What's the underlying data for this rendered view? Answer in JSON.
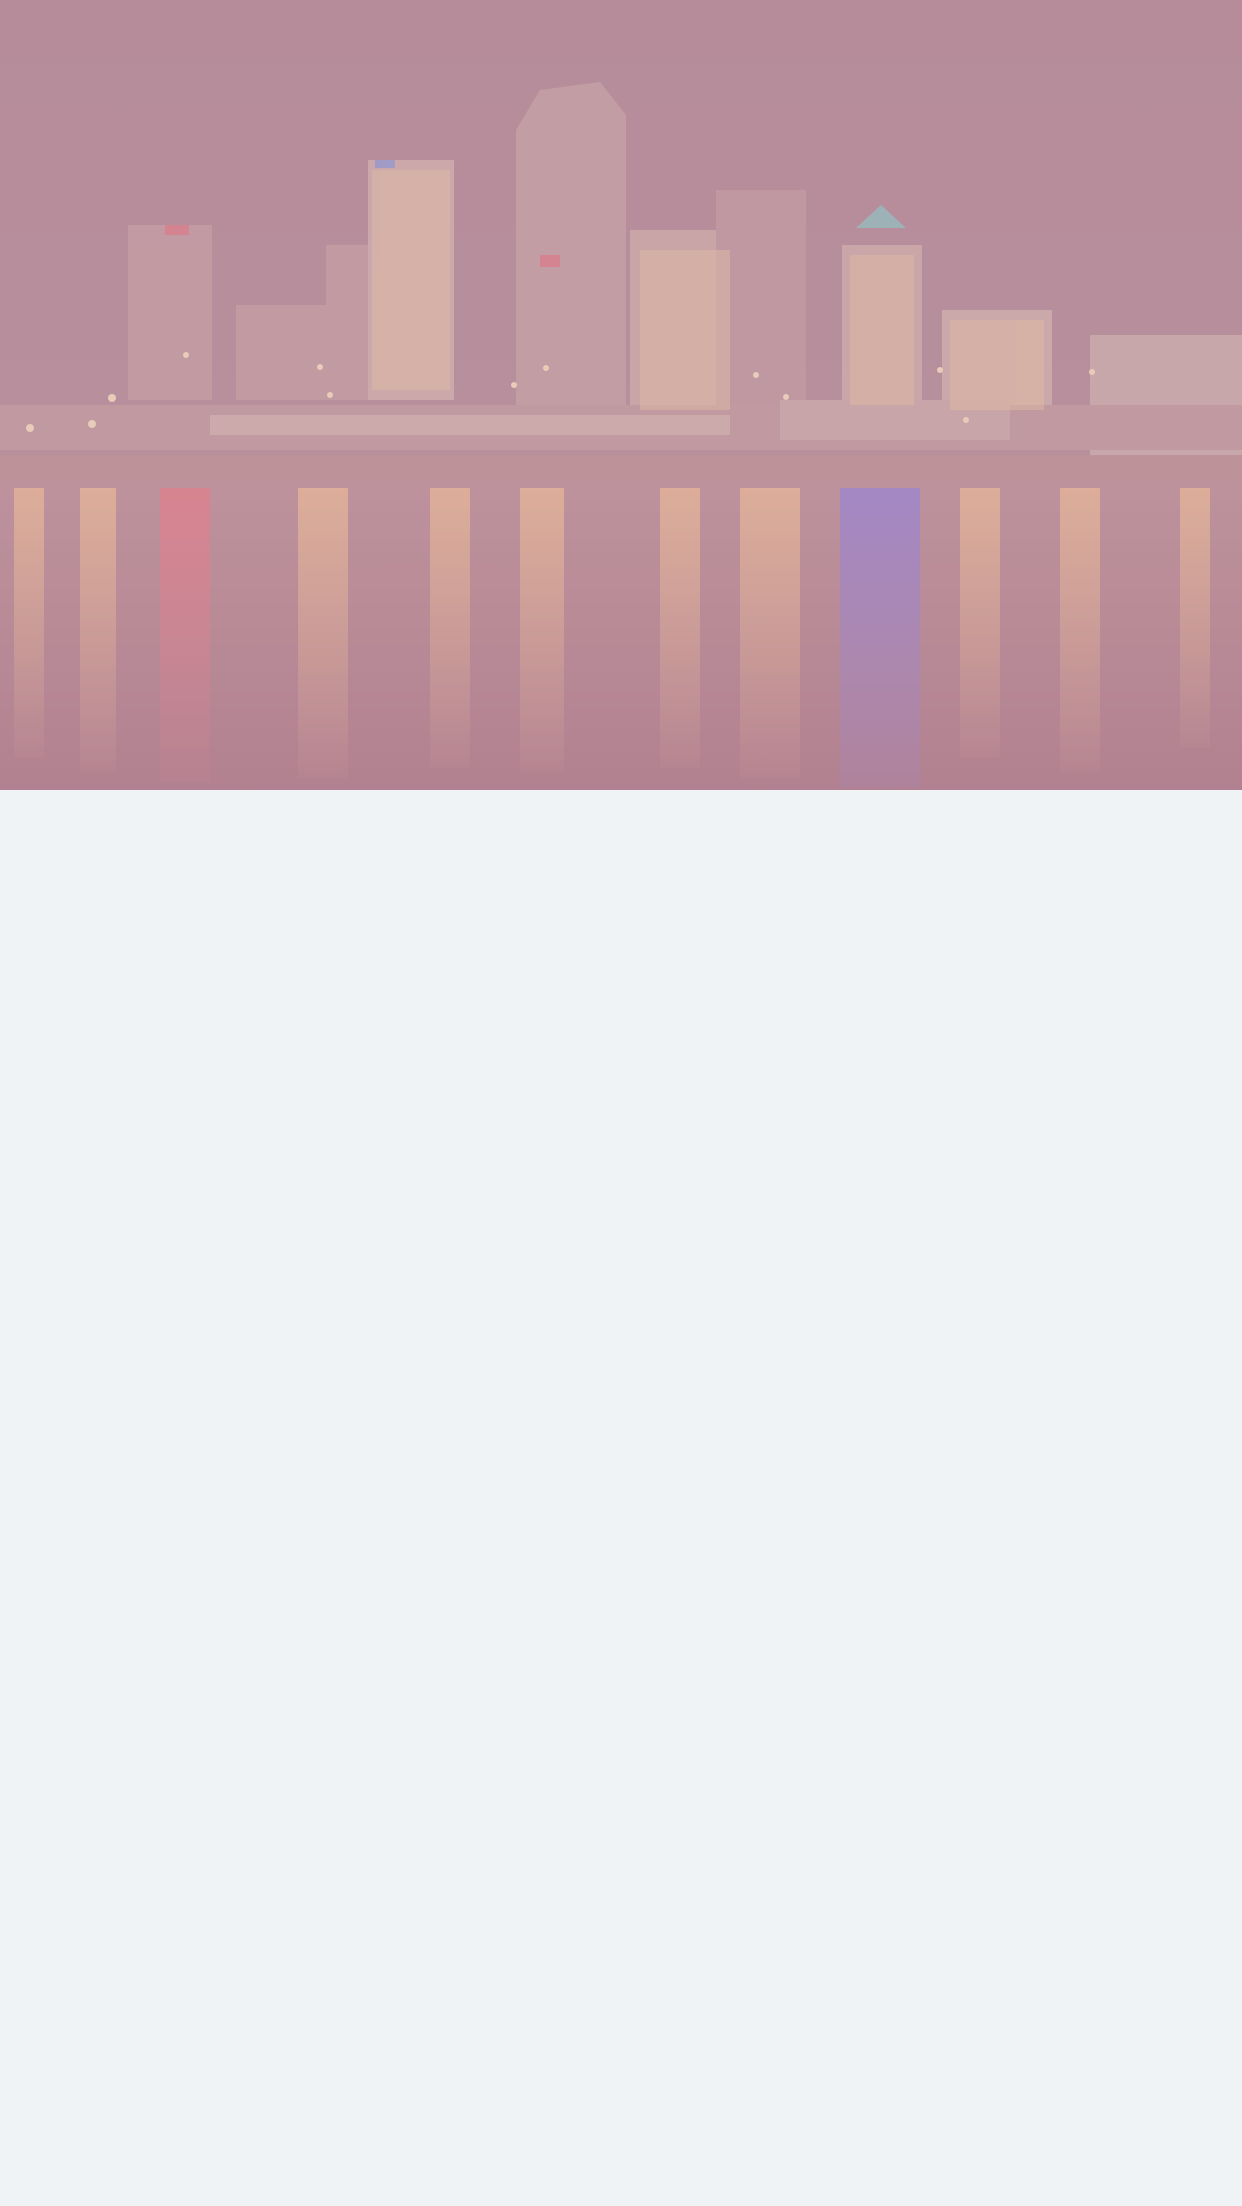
{
  "hero": {
    "overlay_color": "#b98e9e",
    "sky_color": "#b88f9c",
    "water_color": "#b7838f",
    "light_color": "#f3b88a",
    "accent_red": "#e77a88",
    "accent_blue": "#9a7fd1",
    "accent_teal": "#7fc7c0"
  },
  "content": {
    "background_color": "#f0f3f5"
  }
}
